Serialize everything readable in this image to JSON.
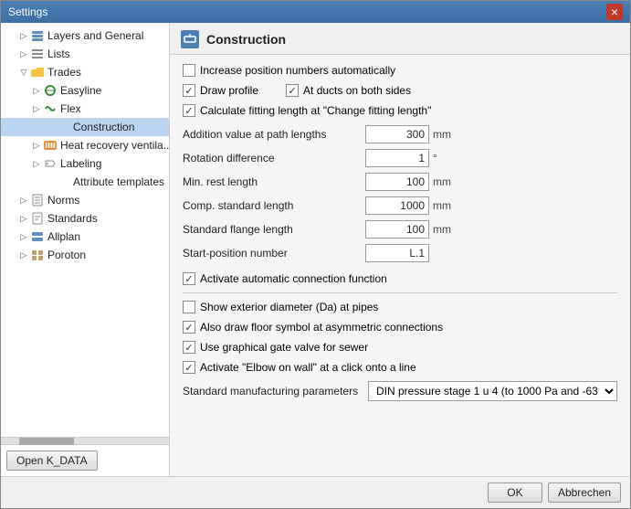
{
  "window": {
    "title": "Settings",
    "close_label": "×"
  },
  "sidebar": {
    "items": [
      {
        "id": "layers-general",
        "label": "Layers and General",
        "indent": 1,
        "expanded": false,
        "selected": false,
        "icon": "layers"
      },
      {
        "id": "lists",
        "label": "Lists",
        "indent": 1,
        "expanded": false,
        "selected": false,
        "icon": "list"
      },
      {
        "id": "trades",
        "label": "Trades",
        "indent": 1,
        "expanded": true,
        "selected": false,
        "icon": "folder"
      },
      {
        "id": "easyline",
        "label": "Easyline",
        "indent": 2,
        "expanded": false,
        "selected": false,
        "icon": "pipe"
      },
      {
        "id": "flex",
        "label": "Flex",
        "indent": 2,
        "expanded": false,
        "selected": false,
        "icon": "pipe"
      },
      {
        "id": "construction",
        "label": "Construction",
        "indent": 3,
        "expanded": false,
        "selected": true,
        "icon": "none"
      },
      {
        "id": "heat-recovery",
        "label": "Heat recovery ventila...",
        "indent": 2,
        "expanded": false,
        "selected": false,
        "icon": "heat"
      },
      {
        "id": "labeling",
        "label": "Labeling",
        "indent": 2,
        "expanded": false,
        "selected": false,
        "icon": "label"
      },
      {
        "id": "attribute-templates",
        "label": "Attribute templates",
        "indent": 3,
        "expanded": false,
        "selected": false,
        "icon": "none"
      },
      {
        "id": "norms",
        "label": "Norms",
        "indent": 1,
        "expanded": false,
        "selected": false,
        "icon": "folder"
      },
      {
        "id": "standards",
        "label": "Standards",
        "indent": 1,
        "expanded": false,
        "selected": false,
        "icon": "folder"
      },
      {
        "id": "allplan",
        "label": "Allplan",
        "indent": 1,
        "expanded": false,
        "selected": false,
        "icon": "layers"
      },
      {
        "id": "poroton",
        "label": "Poroton",
        "indent": 1,
        "expanded": false,
        "selected": false,
        "icon": "brick"
      }
    ],
    "open_k_data_label": "Open K_DATA"
  },
  "right_panel": {
    "header_title": "Construction",
    "settings": {
      "increase_position_numbers": {
        "label": "Increase position numbers automatically",
        "checked": false
      },
      "draw_profile": {
        "label": "Draw profile",
        "checked": true
      },
      "at_ducts_both_sides": {
        "label": "At ducts on both sides",
        "checked": true
      },
      "calculate_fitting_length": {
        "label": "Calculate fitting length at \"Change fitting length\"",
        "checked": true
      },
      "params": [
        {
          "id": "addition-value",
          "label": "Addition value at path lengths",
          "value": "300",
          "unit": "mm"
        },
        {
          "id": "rotation-diff",
          "label": "Rotation difference",
          "value": "1",
          "unit": "°"
        },
        {
          "id": "min-rest-length",
          "label": "Min. rest length",
          "value": "100",
          "unit": "mm"
        },
        {
          "id": "comp-standard-length",
          "label": "Comp. standard length",
          "value": "1000",
          "unit": "mm"
        },
        {
          "id": "standard-flange-length",
          "label": "Standard flange length",
          "value": "100",
          "unit": "mm"
        },
        {
          "id": "start-position-number",
          "label": "Start-position number",
          "value": "L.1",
          "unit": ""
        }
      ],
      "activate_auto_connection": {
        "label": "Activate automatic connection function",
        "checked": true
      },
      "show_exterior_diameter": {
        "label": "Show exterior diameter (Da) at pipes",
        "checked": false
      },
      "also_draw_floor_symbol": {
        "label": "Also draw floor symbol at asymmetric connections",
        "checked": true
      },
      "use_graphical_gate_valve": {
        "label": "Use graphical gate valve for sewer",
        "checked": true
      },
      "activate_elbow_on_wall": {
        "label": "Activate \"Elbow on wall\" at a click onto a line",
        "checked": true
      },
      "standard_manufacturing": {
        "label": "Standard manufacturing parameters",
        "value": "DIN pressure stage 1 u 4 (to 1000 Pa and -63"
      }
    }
  },
  "footer": {
    "ok_label": "OK",
    "cancel_label": "Abbrechen"
  }
}
